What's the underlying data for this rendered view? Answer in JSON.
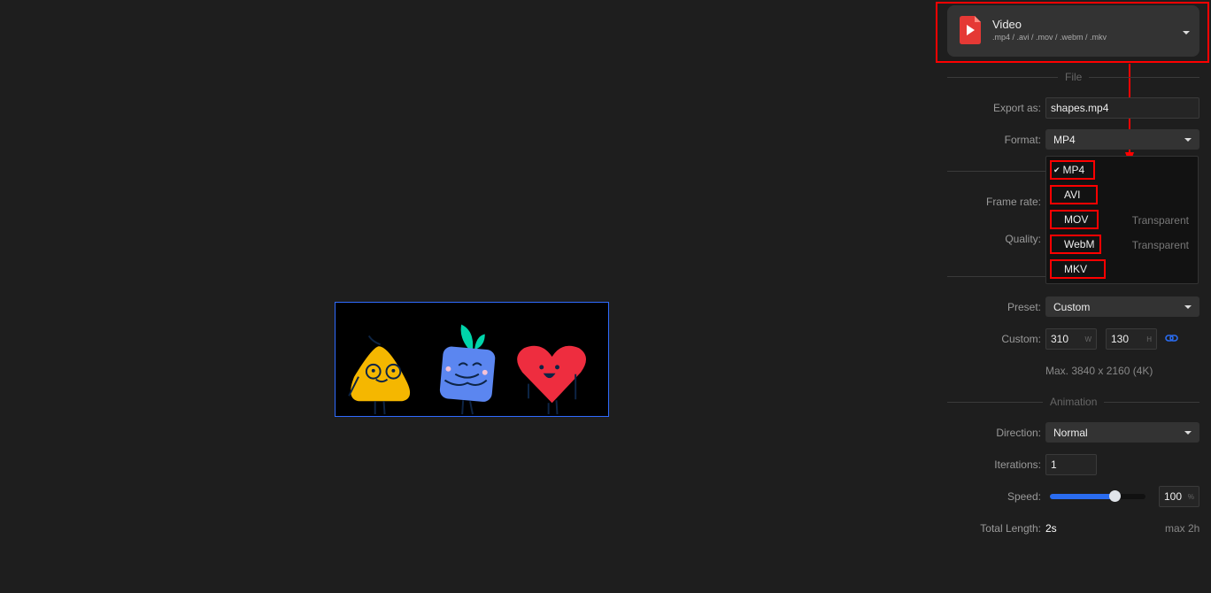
{
  "header": {
    "title": "Video",
    "subtitle": ".mp4 / .avi / .mov / .webm / .mkv",
    "icon": "video-file-icon"
  },
  "sections": {
    "file": "File",
    "animation": "Animation"
  },
  "file": {
    "export_label": "Export as:",
    "export_value": "shapes.mp4",
    "format_label": "Format:",
    "format_value": "MP4",
    "frame_rate_label": "Frame rate:",
    "quality_label": "Quality:",
    "format_options": [
      {
        "label": "MP4",
        "selected": true,
        "note": ""
      },
      {
        "label": "AVI",
        "note": ""
      },
      {
        "label": "MOV",
        "note": "Transparent"
      },
      {
        "label": "WebM",
        "note": "Transparent"
      },
      {
        "label": "MKV",
        "note": ""
      }
    ],
    "check": "✔",
    "preset_label": "Preset:",
    "preset_value": "Custom",
    "custom_label": "Custom:",
    "width": "310",
    "width_unit": "W",
    "height": "130",
    "height_unit": "H",
    "max_text": "Max. 3840 x 2160 (4K)"
  },
  "animation": {
    "direction_label": "Direction:",
    "direction_value": "Normal",
    "iterations_label": "Iterations:",
    "iterations_value": "1",
    "speed_label": "Speed:",
    "speed_value": "100",
    "speed_unit": "%",
    "speed_slider_fraction": 0.68,
    "total_label": "Total Length:",
    "total_value": "2s",
    "max_note": "max 2h"
  },
  "colors": {
    "accent": "#2a6cf0",
    "highlight": "#ff0000",
    "video_icon": "#e53935"
  }
}
